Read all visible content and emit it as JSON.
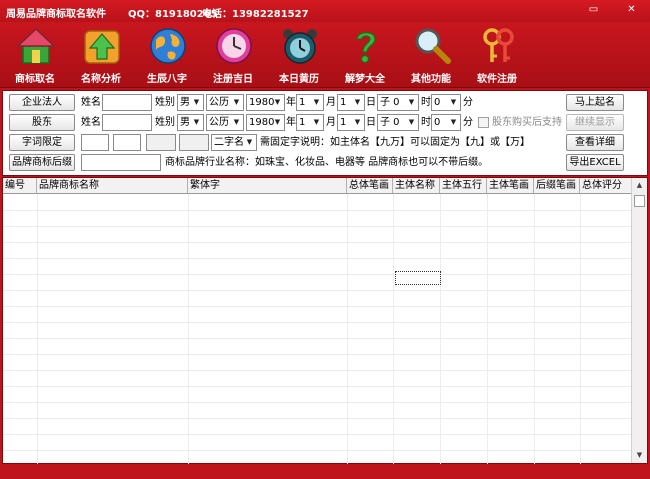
{
  "titlebar": {
    "app_title": "周易品牌商标取名软件",
    "qq": "QQ：819180265",
    "phone": "电话：13982281527",
    "minimize": "▭",
    "close": "✕"
  },
  "toolbar": {
    "items": [
      {
        "label": "商标取名",
        "icon": "house-icon"
      },
      {
        "label": "名称分析",
        "icon": "arrow-up-icon"
      },
      {
        "label": "生辰八字",
        "icon": "globe-icon"
      },
      {
        "label": "注册吉日",
        "icon": "clock-icon"
      },
      {
        "label": "本日黄历",
        "icon": "alarm-clock-icon"
      },
      {
        "label": "解梦大全",
        "icon": "question-mark-icon"
      },
      {
        "label": "其他功能",
        "icon": "magnifier-icon"
      },
      {
        "label": "软件注册",
        "icon": "keys-icon"
      }
    ]
  },
  "form": {
    "row1": {
      "button": "企业法人",
      "name_label": "姓名",
      "name_value": "",
      "gender_label": "姓别",
      "gender": "男",
      "calendar": "公历",
      "year": "1980",
      "year_unit": "年",
      "month": "1",
      "month_unit": "月",
      "day": "1",
      "day_unit": "日",
      "hour": "子 0",
      "hour_unit": "时",
      "minute": "0",
      "minute_unit": "分",
      "action": "马上起名"
    },
    "row2": {
      "button": "股东",
      "name_label": "姓名",
      "name_value": "",
      "gender_label": "姓别",
      "gender": "男",
      "calendar": "公历",
      "year": "1980",
      "year_unit": "年",
      "month": "1",
      "month_unit": "月",
      "day": "1",
      "day_unit": "日",
      "hour": "子 0",
      "hour_unit": "时",
      "minute": "0",
      "minute_unit": "分",
      "checkbox_label": "股东购买后支持",
      "action": "继续显示"
    },
    "row3": {
      "button": "字词限定",
      "word_count": "二字名",
      "note": "需固定字说明：如主体名【九万】可以固定为【九】或【万】",
      "action": "查看详细"
    },
    "row4": {
      "button": "品牌商标后缀",
      "suffix_value": "",
      "note": "商标品牌行业名称：如珠宝、化妆品、电器等 品牌商标也可以不带后缀。",
      "action": "导出EXCEL"
    }
  },
  "table": {
    "columns": [
      "编号",
      "品牌商标名称",
      "繁体字",
      "总体笔画",
      "主体名称",
      "主体五行",
      "主体笔画",
      "后缀笔画",
      "总体评分"
    ]
  },
  "colors": {
    "frame": "#c0141c",
    "toolbar": "#b8121a"
  }
}
